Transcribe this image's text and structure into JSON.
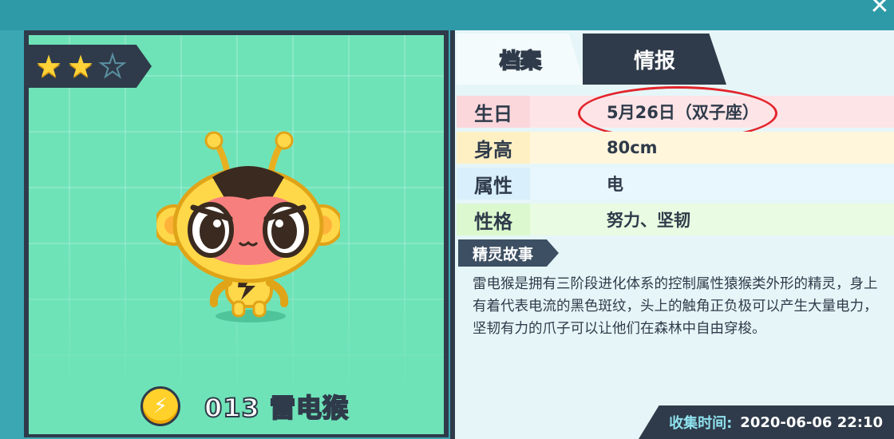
{
  "window": {
    "close_glyph": "✕"
  },
  "pet": {
    "stars": {
      "filled": 2,
      "total": 3
    },
    "number": "013",
    "name": "雷电猴",
    "element_icon": "lightning-icon"
  },
  "tabs": [
    {
      "label": "档案",
      "active": true
    },
    {
      "label": "情报",
      "active": false
    }
  ],
  "profile": {
    "birthday": {
      "key": "生日",
      "value": "5月26日（双子座）"
    },
    "height": {
      "key": "身高",
      "value": "80cm"
    },
    "attribute": {
      "key": "属性",
      "value": "电"
    },
    "personality": {
      "key": "性格",
      "value": "努力、坚韧"
    }
  },
  "story": {
    "label": "精灵故事",
    "text": "雷电猴是拥有三阶段进化体系的控制属性猿猴类外形的精灵，身上有着代表电流的黑色斑纹，头上的触角正负极可以产生大量电力，坚韧有力的爪子可以让他们在森林中自由穿梭。"
  },
  "collect": {
    "label": "收集时间:",
    "time": "2020-06-06 22:10"
  },
  "colors": {
    "accent_dark": "#2f3b4a",
    "bg_green": "#6fe3b8",
    "highlight_circle": "#e3242b",
    "star": "#ffd338"
  }
}
